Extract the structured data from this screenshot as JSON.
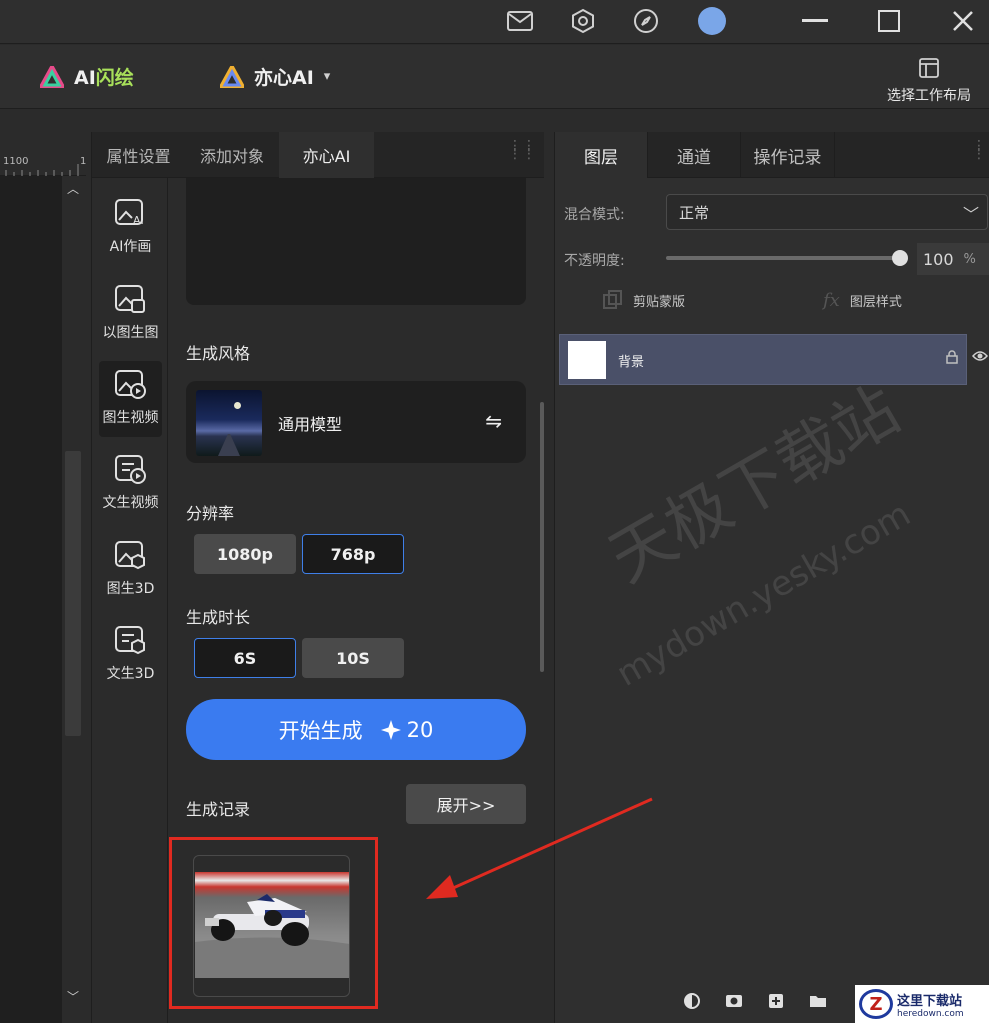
{
  "titlebar": {
    "icons": [
      "mail-icon",
      "hexagon-settings-icon",
      "compass-icon",
      "avatar",
      "minimize-icon",
      "maximize-icon",
      "close-icon"
    ]
  },
  "toolbar": {
    "brand1": {
      "ai": "AI",
      "name": "闪绘"
    },
    "brand2": {
      "name": "亦心AI",
      "caret": "▾"
    },
    "layout_label": "选择工作布局"
  },
  "ruler": {
    "tick_label": "1100",
    "tick_label2": "1"
  },
  "mid": {
    "tabs": [
      "属性设置",
      "添加对象",
      "亦心AI"
    ],
    "sidebar": [
      "AI作画",
      "以图生图",
      "图生视频",
      "文生视频",
      "图生3D",
      "文生3D"
    ],
    "style_label": "生成风格",
    "style_name": "通用模型",
    "resolution_label": "分辨率",
    "resolutions": [
      "1080p",
      "768p"
    ],
    "duration_label": "生成时长",
    "durations": [
      "6S",
      "10S"
    ],
    "generate": {
      "label": "开始生成",
      "cost": "20"
    },
    "history_label": "生成记录",
    "expand_label": "展开>>"
  },
  "right": {
    "tabs": [
      "图层",
      "通道",
      "操作记录"
    ],
    "blend_label": "混合模式:",
    "blend_value": "正常",
    "opacity_label": "不透明度:",
    "opacity_value": "100",
    "opacity_unit": "%",
    "opacity_level": 1.0,
    "clip_mask": "剪贴蒙版",
    "layer_style": "图层样式",
    "layer_name": "背景"
  },
  "watermark": {
    "line1": "天极下载站",
    "line2": "mydown.yesky.com"
  },
  "corner_logo": {
    "line1": "这里下载站",
    "line2": "heredown.com"
  },
  "colors": {
    "accent": "#3a7bf0",
    "highlight": "#e02a20",
    "selected_layer": "#4a5068"
  }
}
